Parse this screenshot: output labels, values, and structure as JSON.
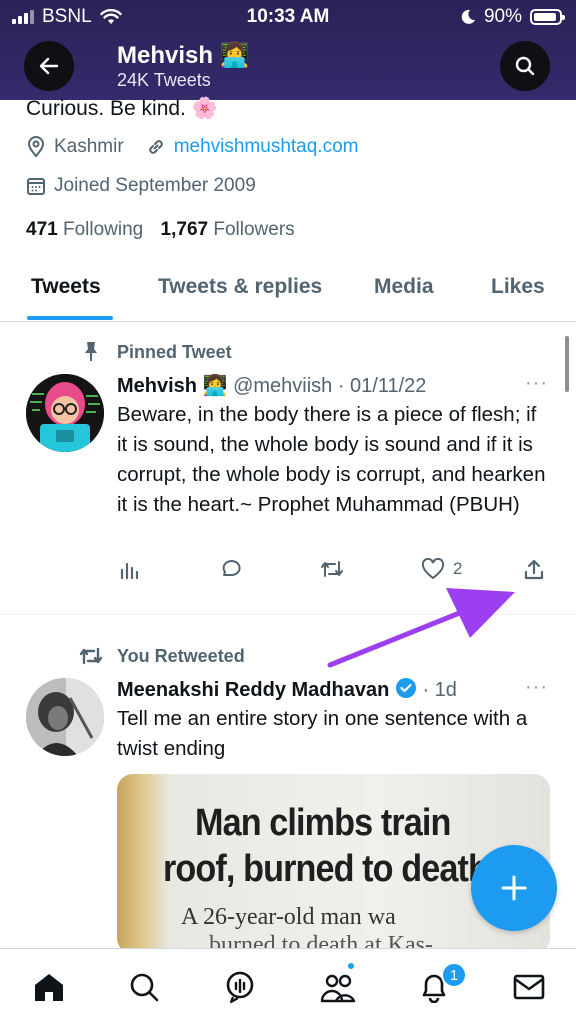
{
  "status_bar": {
    "carrier": "BSNL",
    "time": "10:33 AM",
    "battery": "90%",
    "battery_level": 0.9
  },
  "header": {
    "name": "Mehvish",
    "name_emoji": "👩‍💻",
    "tweet_count": "24K Tweets"
  },
  "profile": {
    "bio": "Curious. Be kind.",
    "bio_emoji": "🌸",
    "location": "Kashmir",
    "website": "mehvishmushtaq.com",
    "joined": "Joined September 2009",
    "following_count": "471",
    "following_label": "Following",
    "followers_count": "1,767",
    "followers_label": "Followers"
  },
  "tabs": [
    {
      "label": "Tweets",
      "active": true
    },
    {
      "label": "Tweets & replies",
      "active": false
    },
    {
      "label": "Media",
      "active": false
    },
    {
      "label": "Likes",
      "active": false
    }
  ],
  "tweets": [
    {
      "context": "Pinned Tweet",
      "author": "Mehvish",
      "author_emoji": "👩‍💻",
      "handle_date": "@mehviish · 01/11/22",
      "text": "Beware, in the body there is a piece of flesh; if it is sound, the whole body is sound and if it is corrupt, the whole body is corrupt, and hearken it is the heart.~ Prophet Muhammad (PBUH)",
      "likes": "2",
      "more": "···"
    },
    {
      "context": "You Retweeted",
      "author": "Meenakshi Reddy Madhavan",
      "handle_date": "· 1d",
      "text": "Tell me an entire story in one sentence with a twist ending",
      "more": "···",
      "media_headline_1": "Man climbs train",
      "media_headline_2": "roof, burned to death",
      "media_body_1": "A 26-year-old   man   wa",
      "media_body_2": "burned to death at Kas-"
    }
  ],
  "nav": {
    "notification_badge": "1"
  },
  "colors": {
    "accent": "#1d9bf0",
    "header_bg": "#2a2358",
    "arrow": "#9b3ff0"
  }
}
